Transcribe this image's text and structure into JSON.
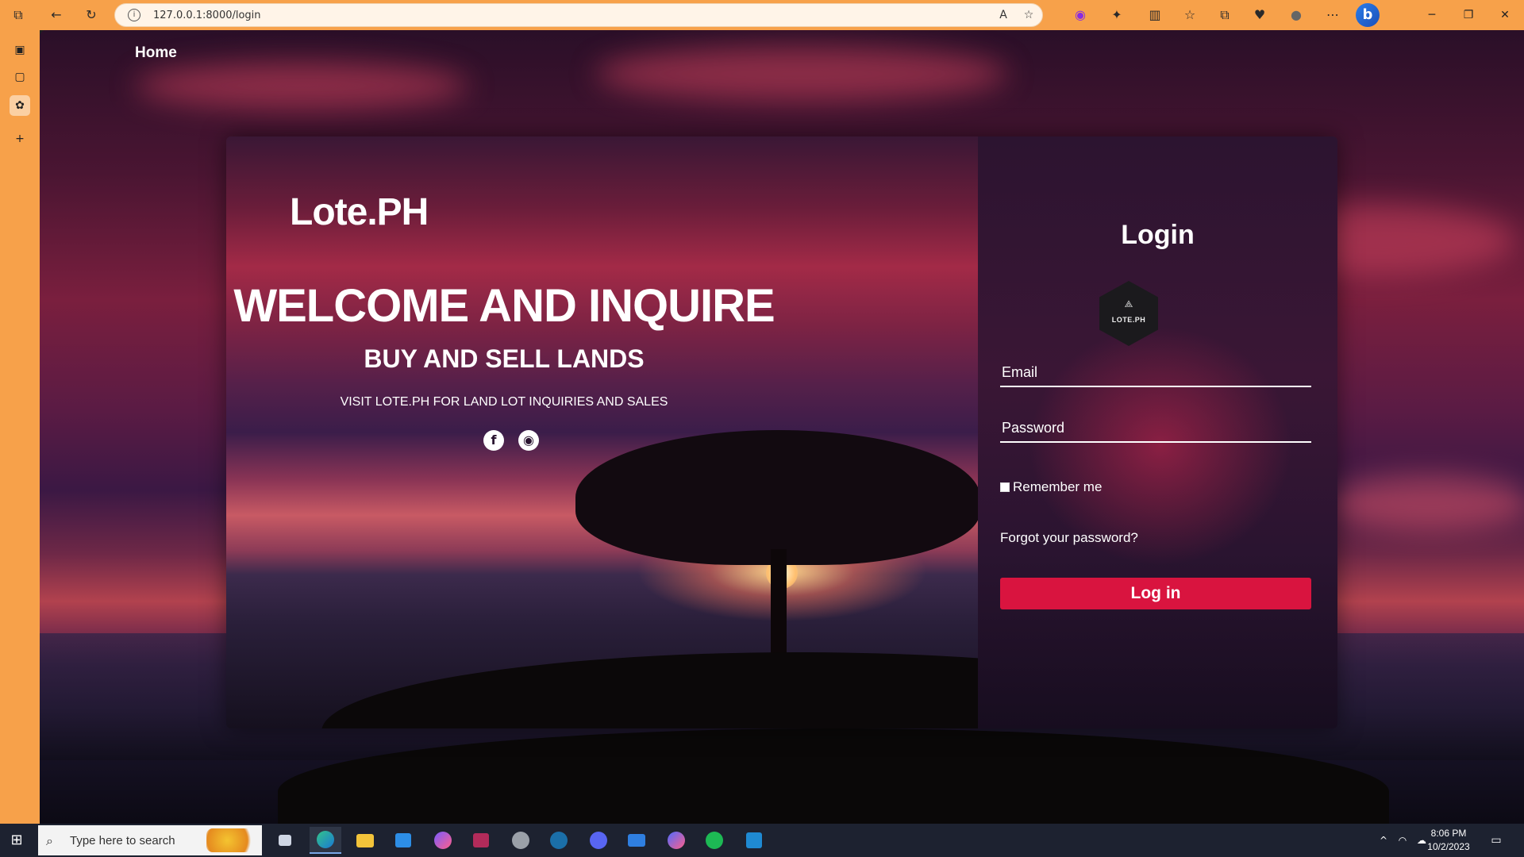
{
  "browser": {
    "url": "127.0.0.1:8000/login",
    "info_icon": "i",
    "read_aloud_icon": "A",
    "favorite_icon": "☆",
    "bing_label": "b"
  },
  "page": {
    "nav_home": "Home",
    "brand": "Lote.PH",
    "welcome": "WELCOME AND INQUIRE",
    "subheading": "BUY AND SELL LANDS",
    "visit": "VISIT LOTE.PH FOR LAND LOT INQUIRIES AND SALES",
    "social": {
      "facebook": "f",
      "github": "◉"
    },
    "login": {
      "title": "Login",
      "logo_text": "LOTE.PH",
      "email_placeholder": "Email",
      "password_placeholder": "Password",
      "remember_label": "Remember me",
      "forgot_label": "Forgot your password?",
      "submit_label": "Log in"
    }
  },
  "taskbar": {
    "search_placeholder": "Type here to search",
    "time": "8:06 PM",
    "date": "10/2/2023"
  }
}
